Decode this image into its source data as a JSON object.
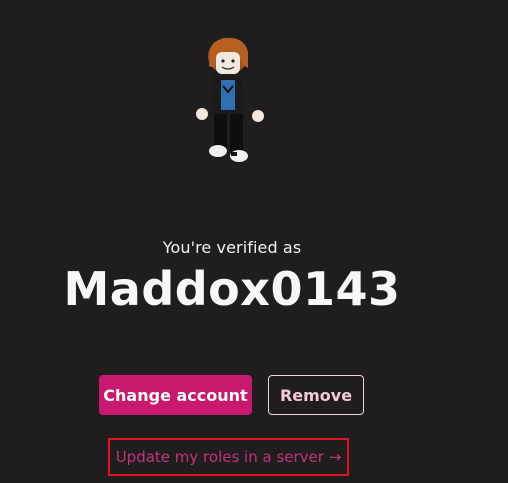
{
  "verification": {
    "label": "You're verified as",
    "username": "Maddox0143"
  },
  "actions": {
    "change_account_label": "Change account",
    "remove_label": "Remove",
    "update_roles_link": "Update my roles in a server →"
  },
  "avatar": {
    "icon": "roblox-avatar"
  },
  "colors": {
    "background": "#201d1f",
    "primary": "#c8196e",
    "outline_text": "#f3c9da",
    "link": "#c0357a",
    "highlight_border": "#e0131f"
  }
}
